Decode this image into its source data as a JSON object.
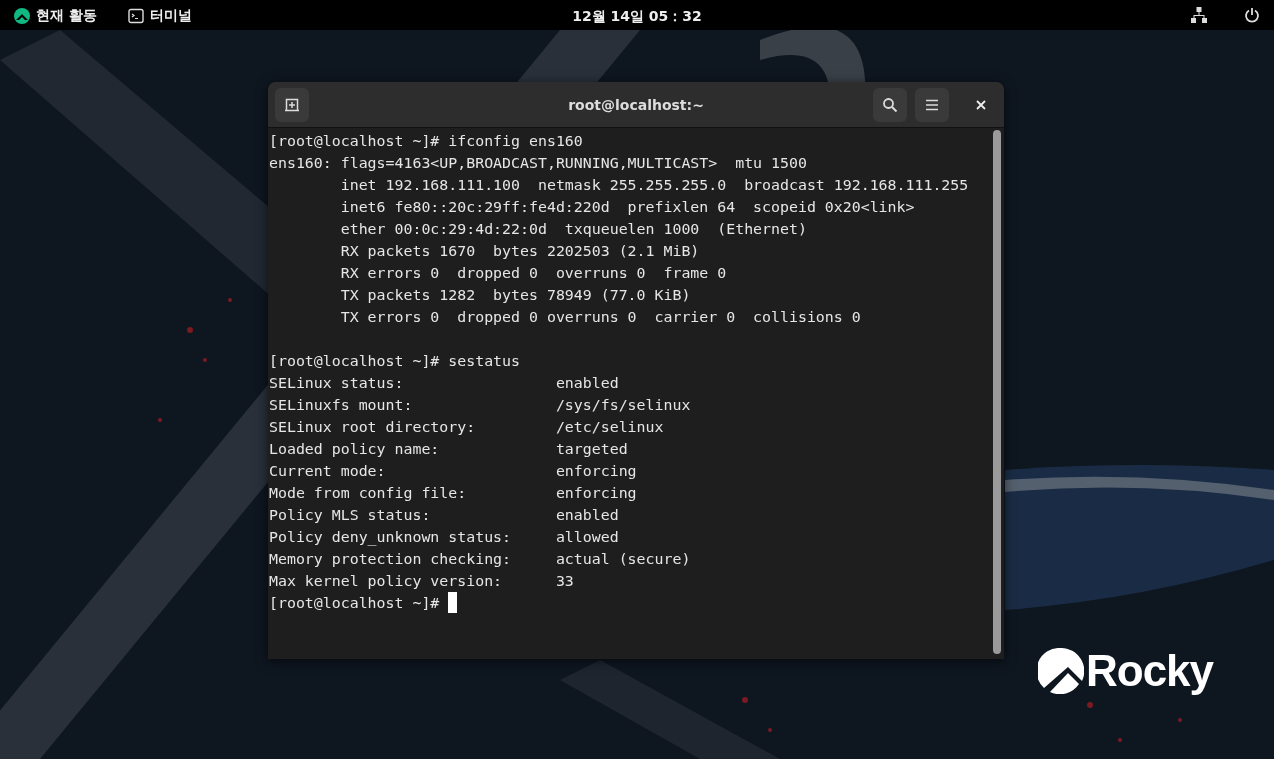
{
  "top_bar": {
    "activities": "현재 활동",
    "app": "터미널",
    "clock": "12월 14일 05：32"
  },
  "window": {
    "title": "root@localhost:~",
    "blocks": [
      {
        "lines": [
          "[root@localhost ~]# ifconfig ens160",
          "ens160: flags=4163<UP,BROADCAST,RUNNING,MULTICAST>  mtu 1500",
          "        inet 192.168.111.100  netmask 255.255.255.0  broadcast 192.168.111.255",
          "        inet6 fe80::20c:29ff:fe4d:220d  prefixlen 64  scopeid 0x20<link>",
          "        ether 00:0c:29:4d:22:0d  txqueuelen 1000  (Ethernet)",
          "        RX packets 1670  bytes 2202503 (2.1 MiB)",
          "        RX errors 0  dropped 0  overruns 0  frame 0",
          "        TX packets 1282  bytes 78949 (77.0 KiB)",
          "        TX errors 0  dropped 0 overruns 0  carrier 0  collisions 0"
        ]
      },
      {
        "lines": [
          "[root@localhost ~]# sestatus",
          "SELinux status:                 enabled",
          "SELinuxfs mount:                /sys/fs/selinux",
          "SELinux root directory:         /etc/selinux",
          "Loaded policy name:             targeted",
          "Current mode:                   enforcing",
          "Mode from config file:          enforcing",
          "Policy MLS status:              enabled",
          "Policy deny_unknown status:     allowed",
          "Memory protection checking:     actual (secure)",
          "Max kernel policy version:      33",
          "[root@localhost ~]# "
        ]
      }
    ]
  },
  "logo": {
    "text": "Rocky"
  }
}
